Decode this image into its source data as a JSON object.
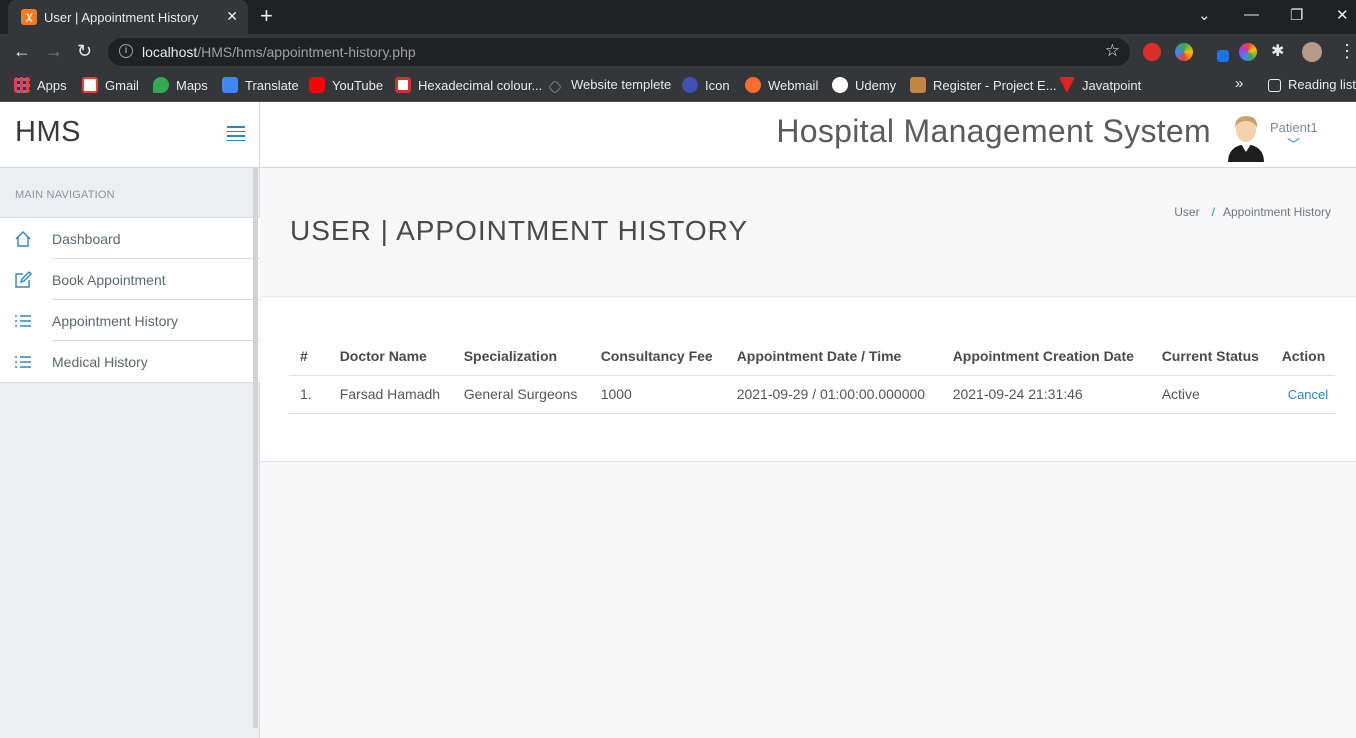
{
  "browser": {
    "tab_title": "User | Appointment History",
    "url_host": "localhost",
    "url_path": "/HMS/hms/appointment-history.php",
    "bookmarks": [
      "Apps",
      "Gmail",
      "Maps",
      "Translate",
      "YouTube",
      "Hexadecimal colour...",
      "Website templete",
      "Icon",
      "Webmail",
      "Udemy",
      "Register - Project E...",
      "Javatpoint"
    ],
    "overflow": "»",
    "reading_list": "Reading list"
  },
  "app": {
    "brand": "HMS",
    "title": "Hospital Management System",
    "user": "Patient1"
  },
  "sidebar": {
    "heading": "MAIN NAVIGATION",
    "items": [
      {
        "label": "Dashboard",
        "icon": "home-icon"
      },
      {
        "label": "Book Appointment",
        "icon": "edit-icon"
      },
      {
        "label": "Appointment History",
        "icon": "list-icon"
      },
      {
        "label": "Medical History",
        "icon": "list-icon"
      }
    ]
  },
  "page": {
    "heading": "USER | APPOINTMENT HISTORY",
    "breadcrumb": [
      "User",
      "Appointment History"
    ]
  },
  "table": {
    "headers": [
      "#",
      "Doctor Name",
      "Specialization",
      "Consultancy Fee",
      "Appointment Date / Time",
      "Appointment Creation Date",
      "Current Status",
      "Action"
    ],
    "rows": [
      {
        "num": "1.",
        "doctor": "Farsad Hamadh",
        "spec": "General Surgeons",
        "fee": "1000",
        "datetime": "2021-09-29 / 01:00:00.000000",
        "created": "2021-09-24 21:31:46",
        "status": "Active",
        "action": "Cancel"
      }
    ]
  },
  "colors": {
    "accent": "#2e86c1",
    "chrome_dark": "#202124",
    "chrome": "#35363a"
  }
}
